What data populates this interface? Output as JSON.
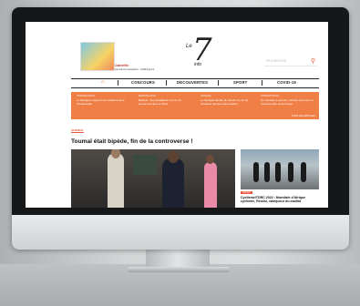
{
  "promo": {
    "title": "Calenfête",
    "subtitle": "La bonne reception - 24/24 jours"
  },
  "logo": {
    "prefix": "Le",
    "number": "7",
    "suffix": "info"
  },
  "search": {
    "placeholder": "RECHERCHE"
  },
  "nav": {
    "items": [
      "CONCOURS",
      "DECOUVERTES",
      "SPORT",
      "COVID-19"
    ]
  },
  "band": {
    "items": [
      {
        "category": "INTERNATIONAL",
        "title": "Le Mexique suspend ses relations avec l'Ambassade"
      },
      {
        "category": "BURKINA FASO",
        "title": "Burkina : des assaillants ont tué 14 personnes dans le Nord"
      },
      {
        "category": "AFRIQUE",
        "title": "Le Sénégal décide de réduire le prix de certaines denrées alimentaires"
      },
      {
        "category": "INTERNATIONAL",
        "title": "Au Canada, le premier ministre annonce un nouveau plan économique"
      }
    ],
    "more": "TOUS LES ARTICLES"
  },
  "main": {
    "kicker": "SCIENCE",
    "headline": "Toumaï était bipède, fin de la controverse !"
  },
  "side": {
    "tag": "SPORT",
    "title": "Cyclisme/TDRC 2022 : Mondiale d'Afrique cyclisme, Réussi, vainqueur du maillot"
  }
}
